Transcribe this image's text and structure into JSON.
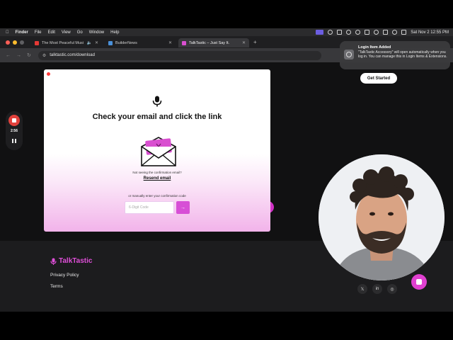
{
  "menubar": {
    "app": "Finder",
    "menus": [
      "File",
      "Edit",
      "View",
      "Go",
      "Window",
      "Help"
    ],
    "datetime": "Sat Nov 2  12:55 PM"
  },
  "tabs": [
    {
      "title": "The Most Peaceful Music",
      "favicon_color": "#e53935",
      "active": false
    },
    {
      "title": "BuilderNews",
      "favicon_color": "#4a90d9",
      "active": false
    },
    {
      "title": "TalkTastic – Just Say It.",
      "favicon_color": "#d94fd0",
      "active": true
    }
  ],
  "address": {
    "url": "talktastic.com/download"
  },
  "modal": {
    "title": "Check your email and click the link",
    "not_seeing": "Not seeing the confirmation email?",
    "resend": "Resend email",
    "manually": "or manually enter your confirmation code",
    "code_placeholder": "6-Digit Code",
    "submit": "→"
  },
  "recorder": {
    "time": "2:56"
  },
  "notification": {
    "title": "Login Item Added",
    "body": "\"TalkTastic Accessory\" will open automatically when you log in. You can manage this in Login Items & Extensions.",
    "button": "Get Started"
  },
  "footer": {
    "brand": "TalkTastic",
    "privacy": "Privacy Policy",
    "terms": "Terms",
    "social": [
      "𝕏",
      "in",
      "◎"
    ]
  },
  "colors": {
    "accent": "#d94fd0",
    "record": "#e2413c"
  }
}
